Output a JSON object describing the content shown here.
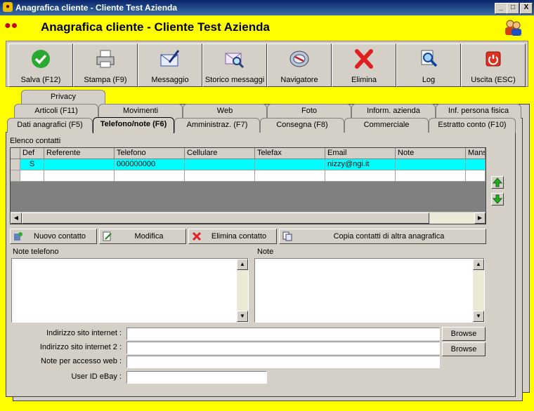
{
  "window": {
    "title": "Anagrafica cliente - Cliente Test Azienda",
    "controls": [
      "_",
      "□",
      "X"
    ]
  },
  "header": {
    "title": "Anagrafica cliente - Cliente Test Azienda"
  },
  "toolbar": [
    {
      "label": "Salva (F12)",
      "icon": "check-icon"
    },
    {
      "label": "Stampa (F9)",
      "icon": "printer-icon"
    },
    {
      "label": "Messaggio",
      "icon": "envelope-pen-icon"
    },
    {
      "label": "Storico messaggi",
      "icon": "envelope-search-icon"
    },
    {
      "label": "Navigatore",
      "icon": "compass-icon"
    },
    {
      "label": "Elimina",
      "icon": "delete-x-icon"
    },
    {
      "label": "Log",
      "icon": "log-search-icon"
    },
    {
      "label": "Uscita (ESC)",
      "icon": "power-icon"
    }
  ],
  "tabs": {
    "row1": [
      "Privacy"
    ],
    "row2": [
      "Articoli (F11)",
      "Movimenti",
      "Web",
      "Foto",
      "Inform. azienda",
      "Inf. persona fisica"
    ],
    "row3": [
      "Dati anagrafici (F5)",
      "Telefono/note (F6)",
      "Amministraz. (F7)",
      "Consegna (F8)",
      "Commerciale",
      "Estratto conto (F10)"
    ],
    "active": "Telefono/note (F6)"
  },
  "contacts": {
    "label": "Elenco contatti",
    "columns": [
      "Def",
      "Referente",
      "Telefono",
      "Cellulare",
      "Telefax",
      "Email",
      "Note",
      "Mans"
    ],
    "rows": [
      [
        "S",
        "",
        "000000000",
        "",
        "",
        "nizzy@ngi.it",
        "",
        ""
      ],
      [
        "",
        "",
        "",
        "",
        "",
        "",
        "",
        ""
      ]
    ]
  },
  "actions": {
    "new": "Nuovo contatto",
    "edit": "Modifica",
    "delete": "Elimina contatto",
    "copy": "Copia contatti di altra anagrafica"
  },
  "memos": {
    "phone_notes_label": "Note telefono",
    "notes_label": "Note"
  },
  "fields": {
    "website_label": "Indirizzo sito internet :",
    "website2_label": "Indirizzo sito internet 2 :",
    "web_notes_label": "Note per accesso web :",
    "ebay_label": "User ID eBay :",
    "browse": "Browse"
  },
  "colors": {
    "accent_frame": "#ffff00",
    "selected_row": "#00ffff"
  }
}
